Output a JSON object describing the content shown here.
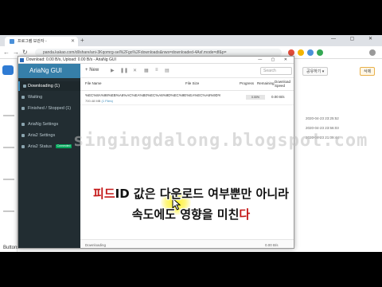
{
  "browser": {
    "tab_title": "프로그램 보관자 -",
    "url": "panda.kakao.com/dl/share/ani-3Kqomrg-sel%2Fgo%2Fdownloads&nws=downloaded-4Asf.mode=df&p=",
    "new_tab_symbol": "+",
    "window_controls": "— ▢ ✕"
  },
  "background_app": {
    "right_pills": [
      "공유하기 ▾",
      "삭제"
    ],
    "dates": [
      "2020-04-23 23:25:52",
      "2020-04-23 23:56:03",
      "2020-04-23 21:09:44"
    ],
    "footer_label": "Buttons"
  },
  "popup": {
    "title": "Download: 0.00 B/s, Upload: 0.00 B/s - AriaNg GUI",
    "window_controls": "— ▢ ✕",
    "brand": "AriaNg GUI",
    "sidebar": {
      "items": [
        {
          "label": "Downloading (1)",
          "active": true
        },
        {
          "label": "Waiting",
          "active": false
        },
        {
          "label": "Finished / Stopped (1)",
          "active": false
        }
      ],
      "settings_items": [
        {
          "label": "AriaNg Settings"
        },
        {
          "label": "Aria2 Settings"
        },
        {
          "label": "Aria2 Status",
          "badge": "Connected"
        }
      ]
    },
    "toolbar": {
      "new_label": "New",
      "search_placeholder": "Search"
    },
    "columns": {
      "file_name": "File Name",
      "file_size": "File Size",
      "progress": "Progress",
      "remaining": "Remaining",
      "download_speed": "Download Speed"
    },
    "task": {
      "name": "%EC%8A%98%EB%A6%AC%EA%B0%EC%A6%9D%EC%9E%EA%EC%A6%9D%EC%97...",
      "size": "700.48 MB",
      "files": "(1 Files)",
      "progress_value": 0,
      "progress_text": "0.00%",
      "speed": "0.00 B/s"
    },
    "status": {
      "left": "Downloading",
      "right": "0.00 B/s"
    }
  },
  "watermark": "singingdalong.blogspot.com",
  "caption": {
    "line1_highlight": "피드",
    "line1_rest": "ID 값은 다운로드 여부뿐만 아니라",
    "line2_rest": "속도에도 영향을 미친",
    "line2_highlight": "다"
  }
}
